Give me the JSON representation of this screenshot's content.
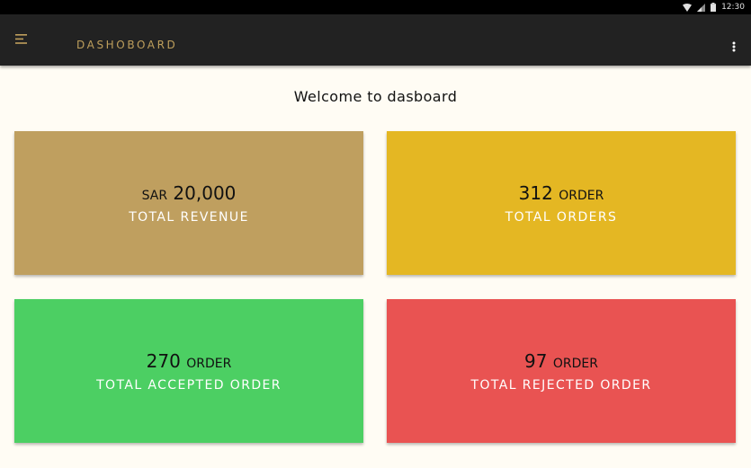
{
  "status_bar": {
    "time": "12:30"
  },
  "app_bar": {
    "title": "DASHOBOARD"
  },
  "welcome": "Welcome to dasboard",
  "cards": [
    {
      "prefix": "SAR",
      "value": "20,000",
      "suffix": "",
      "label": "TOTAL REVENUE",
      "color": "#bf9f5f"
    },
    {
      "prefix": "",
      "value": "312",
      "suffix": "ORDER",
      "label": "TOTAL ORDERS",
      "color": "#e4b723"
    },
    {
      "prefix": "",
      "value": "270",
      "suffix": "ORDER",
      "label": "TOTAL ACCEPTED ORDER",
      "color": "#4ccf63"
    },
    {
      "prefix": "",
      "value": "97",
      "suffix": "ORDER",
      "label": "TOTAL REJECTED ORDER",
      "color": "#e95352"
    }
  ],
  "colors": {
    "app_bar": "#222222",
    "title": "#bf9f5c",
    "background": "#fffcf4"
  },
  "icons": {
    "menu": "menu-icon",
    "more": "more-vertical-icon",
    "wifi": "wifi-icon",
    "signal": "signal-icon",
    "battery": "battery-icon"
  }
}
